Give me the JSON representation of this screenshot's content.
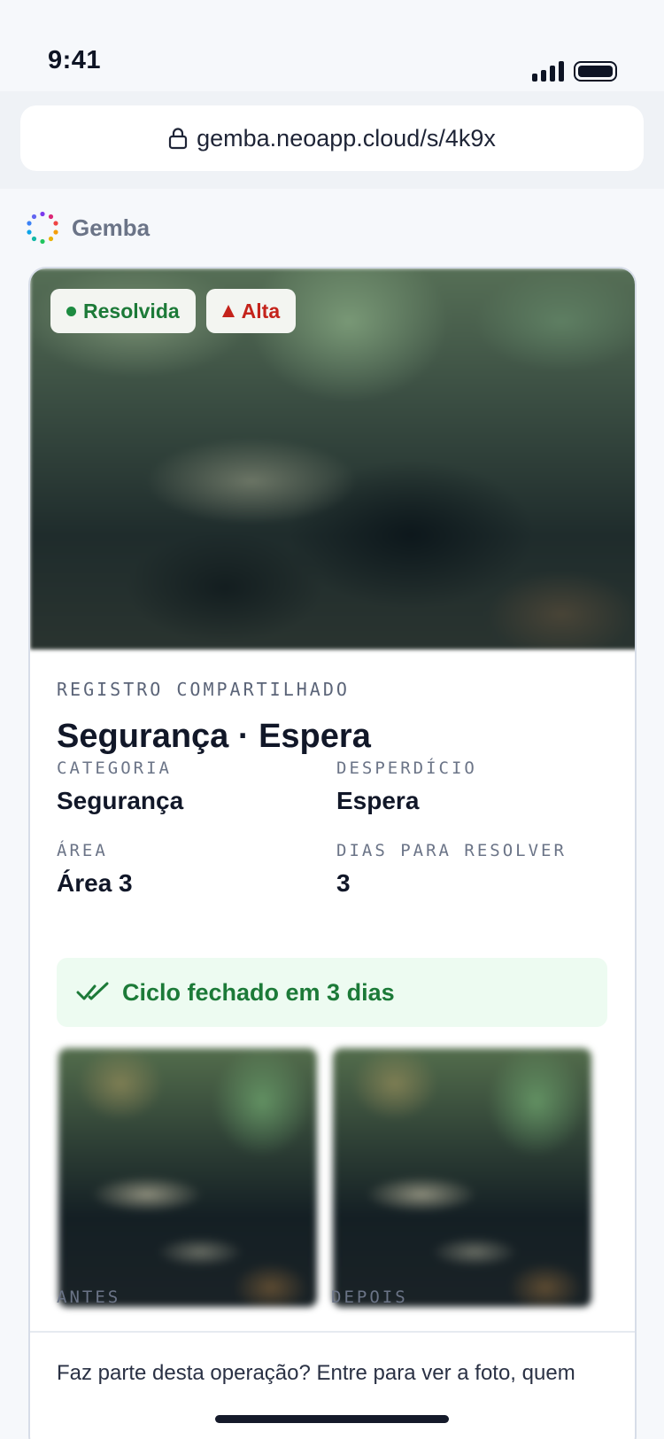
{
  "status_bar": {
    "time": "9:41"
  },
  "browser": {
    "url": "gemba.neoapp.cloud/s/4k9x"
  },
  "brand": {
    "name": "Gemba"
  },
  "card": {
    "badges": [
      {
        "label": "Resolvida",
        "color": "#1c7a38"
      },
      {
        "label": "Alta",
        "color": "#c4231b"
      }
    ],
    "eyebrow": "REGISTRO COMPARTILHADO",
    "title": "Segurança · Espera",
    "fields": [
      {
        "label": "CATEGORIA",
        "value": "Segurança"
      },
      {
        "label": "DESPERDÍCIO",
        "value": "Espera"
      },
      {
        "label": "ÁREA",
        "value": "Área 3"
      },
      {
        "label": "DIAS PARA RESOLVER",
        "value": "3"
      }
    ],
    "cycle_status": "Ciclo fechado em 3 dias",
    "photos": [
      {
        "label": "ANTES"
      },
      {
        "label": "DEPOIS"
      }
    ],
    "footer_text": "Faz parte desta operação? Entre para ver a foto, quem"
  },
  "colors": {
    "accent_green": "#1c7a38",
    "accent_red": "#c4231b",
    "text_dark": "#111728"
  }
}
